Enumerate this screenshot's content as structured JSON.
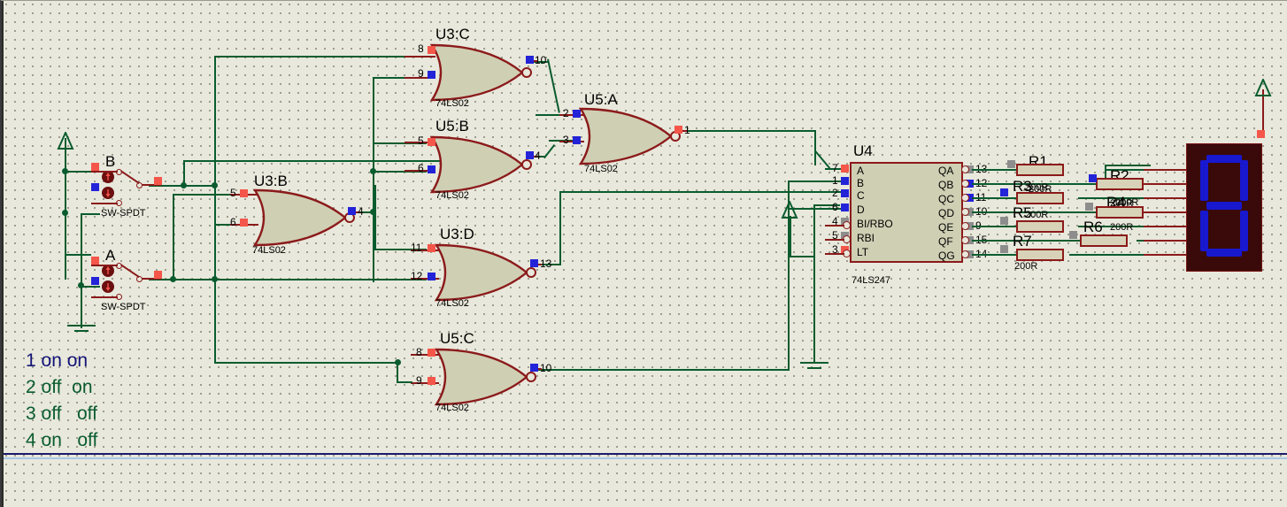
{
  "app": {
    "kind": "circuit-schematic-simulation",
    "background_color": "#e8e8dc",
    "wire_color": "#0a5c2e",
    "body_color": "#8b1a1a"
  },
  "gates": [
    {
      "id": "u3c",
      "ref": "U3:C",
      "value": "74LS02",
      "inputs": [
        {
          "pin": "8",
          "state": "red"
        },
        {
          "pin": "9",
          "state": "blue"
        }
      ],
      "output": {
        "pin": "10",
        "state": "blue"
      }
    },
    {
      "id": "u5b",
      "ref": "U5:B",
      "value": "74LS02",
      "inputs": [
        {
          "pin": "5",
          "state": "red"
        },
        {
          "pin": "6",
          "state": "blue"
        }
      ],
      "output": {
        "pin": "4",
        "state": "blue"
      }
    },
    {
      "id": "u5a",
      "ref": "U5:A",
      "value": "74LS02",
      "inputs": [
        {
          "pin": "2",
          "state": "blue"
        },
        {
          "pin": "3",
          "state": "blue"
        }
      ],
      "output": {
        "pin": "1",
        "state": "red"
      }
    },
    {
      "id": "u3b",
      "ref": "U3:B",
      "value": "74LS02",
      "inputs": [
        {
          "pin": "5",
          "state": "red"
        },
        {
          "pin": "6",
          "state": "red"
        }
      ],
      "output": {
        "pin": "4",
        "state": "blue"
      }
    },
    {
      "id": "u3d",
      "ref": "U3:D",
      "value": "74LS02",
      "inputs": [
        {
          "pin": "11",
          "state": "red"
        },
        {
          "pin": "12",
          "state": "blue"
        }
      ],
      "output": {
        "pin": "13",
        "state": "blue"
      }
    },
    {
      "id": "u5c",
      "ref": "U5:C",
      "value": "74LS02",
      "inputs": [
        {
          "pin": "8",
          "state": "red"
        },
        {
          "pin": "9",
          "state": "red"
        }
      ],
      "output": {
        "pin": "10",
        "state": "blue"
      }
    }
  ],
  "ic": {
    "ref": "U4",
    "value": "74LS247",
    "inputs": [
      {
        "pin": "7",
        "name": "A",
        "state": "red"
      },
      {
        "pin": "1",
        "name": "B",
        "state": "blue"
      },
      {
        "pin": "2",
        "name": "C",
        "state": "blue"
      },
      {
        "pin": "6",
        "name": "D",
        "state": "blue"
      },
      {
        "pin": "4",
        "name": "BI/RBO",
        "state": "gray"
      },
      {
        "pin": "5",
        "name": "RBI",
        "state": "gray"
      },
      {
        "pin": "3",
        "name": "LT",
        "state": "red"
      }
    ],
    "outputs": [
      {
        "pin": "13",
        "name": "QA",
        "state": "gray"
      },
      {
        "pin": "12",
        "name": "QB",
        "state": "blue"
      },
      {
        "pin": "11",
        "name": "QC",
        "state": "blue"
      },
      {
        "pin": "10",
        "name": "QD",
        "state": "gray"
      },
      {
        "pin": "9",
        "name": "QE",
        "state": "gray"
      },
      {
        "pin": "15",
        "name": "QF",
        "state": "gray"
      },
      {
        "pin": "14",
        "name": "QG",
        "state": "gray"
      }
    ]
  },
  "switches": [
    {
      "id": "swb",
      "ref": "B",
      "value": "SW-SPDT"
    },
    {
      "id": "swa",
      "ref": "A",
      "value": "SW-SPDT"
    }
  ],
  "resistors": [
    {
      "ref": "R1",
      "value": "200R"
    },
    {
      "ref": "R2",
      "value": "200R"
    },
    {
      "ref": "R3",
      "value": "200R"
    },
    {
      "ref": "R4",
      "value": "200R"
    },
    {
      "ref": "R5",
      "value": "200R"
    },
    {
      "ref": "R6",
      "value": "200R"
    },
    {
      "ref": "R7",
      "value": "200R"
    }
  ],
  "display": {
    "name": "7seg-display",
    "segments_on": [
      "a",
      "b",
      "c",
      "d",
      "e",
      "f",
      "g"
    ],
    "segment_color": "#1818cf",
    "body_color": "#3a0a0a"
  },
  "legend": [
    {
      "index": "1",
      "b": "on",
      "a": "on",
      "color": "navy"
    },
    {
      "index": "2",
      "b": "off",
      "a": "on",
      "color": "green"
    },
    {
      "index": "3",
      "b": "off",
      "a": "off",
      "color": "green"
    },
    {
      "index": "4",
      "b": "on",
      "a": "off",
      "color": "green"
    }
  ],
  "legend_lines": [
    "1 on on",
    "2 off  on",
    "3 off   off",
    "4 on   off"
  ]
}
